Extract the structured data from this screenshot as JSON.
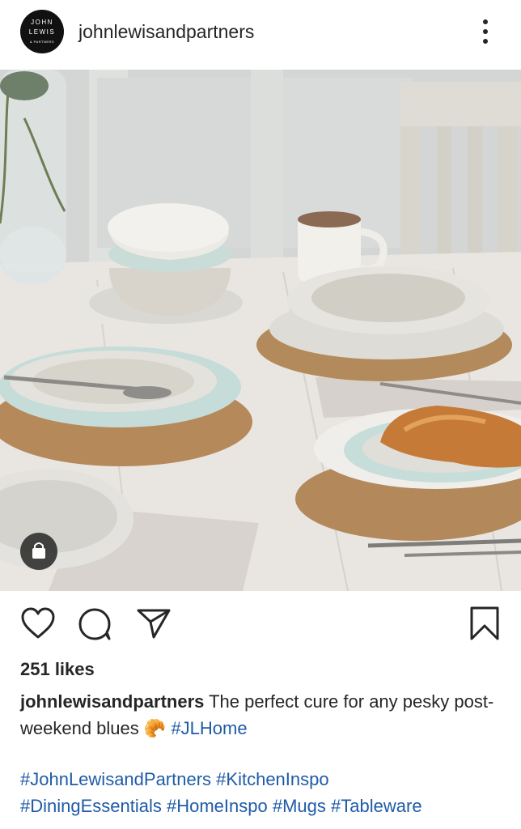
{
  "header": {
    "avatar_line1": "JOHN",
    "avatar_line2": "LEWIS",
    "avatar_line3": "& PARTNERS",
    "username": "johnlewisandpartners",
    "more_icon": "more-vertical-icon"
  },
  "post": {
    "image_icon": "shopping-bag-icon",
    "actions": [
      "heart-icon",
      "comment-icon",
      "share-icon",
      "bookmark-icon"
    ],
    "likes": "251 likes",
    "caption_user": "johnlewisandpartners",
    "caption_text": "The perfect cure for any pesky post-weekend blues",
    "caption_emoji": "🥐",
    "caption_tag": "#JLHome",
    "hashtags": [
      "#JohnLewisandPartners",
      "#KitchenInspo",
      "#DiningEssentials",
      "#HomeInspo",
      "#Mugs",
      "#Tableware"
    ]
  },
  "colors": {
    "hashtag": "#1f5ba7",
    "text": "#262626"
  }
}
